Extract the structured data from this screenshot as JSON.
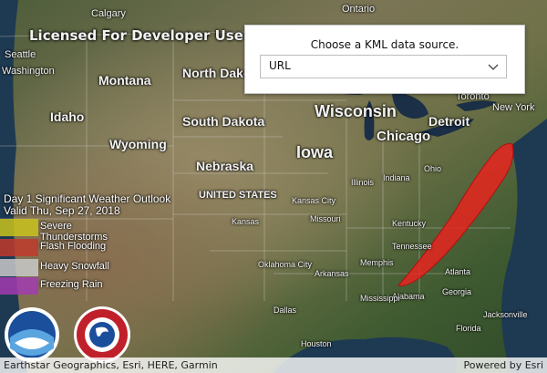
{
  "license_watermark": "Licensed For Developer Use Only",
  "kml_panel": {
    "title": "Choose a KML data source.",
    "selected_source": "URL",
    "dropdown_icon": "chevron-down-icon"
  },
  "legend": {
    "title_line1": "Day 1 Significant Weather Outlook",
    "title_line2": "Valid Thu, Sep 27, 2018",
    "items": [
      {
        "label": "Severe Thunderstorms",
        "color": "#c9c21c"
      },
      {
        "label": "Flash Flooding",
        "color": "#c0392b"
      },
      {
        "label": "Heavy Snowfall",
        "color": "#c9c9c9"
      },
      {
        "label": "Freezing Rain",
        "color": "#a23bb0"
      }
    ]
  },
  "map_labels": {
    "states": [
      "North Dakota",
      "South Dakota",
      "Montana",
      "Idaho",
      "Wyoming",
      "Nebraska",
      "Iowa",
      "Wisconsin"
    ],
    "country": "UNITED STATES",
    "cities": [
      "Calgary",
      "Ontario",
      "Seattle",
      "Washington",
      "Chicago",
      "Detroit",
      "Toronto",
      "New York",
      "Kansas City",
      "Oklahoma City",
      "Dallas",
      "Memphis",
      "Atlanta",
      "Houston",
      "Jacksonville",
      "Kansas",
      "Missouri",
      "Alabama",
      "Mississippi",
      "Georgia",
      "Florida",
      "Arkansas",
      "Illinois",
      "Indiana",
      "Ohio",
      "Kentucky",
      "Tennessee"
    ]
  },
  "attribution": {
    "left": "Earthstar Geographics, Esri, HERE, Garmin",
    "right": "Powered by Esri"
  },
  "logos": [
    "noaa-logo",
    "national-weather-service-logo"
  ],
  "colors": {
    "flood_polygon": "#e8241e",
    "panel_bg": "#ffffff"
  }
}
